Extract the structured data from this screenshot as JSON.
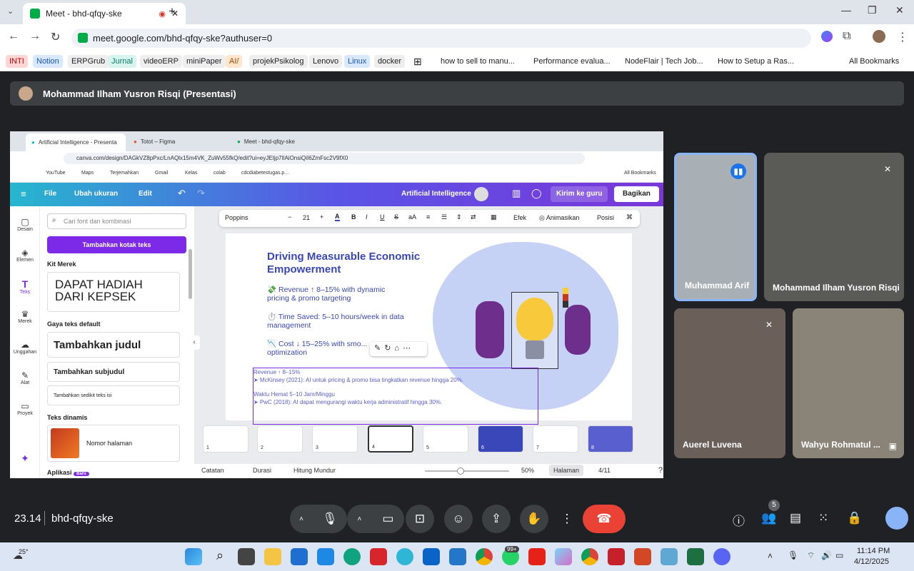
{
  "browser": {
    "tab_title": "Meet - bhd-qfqy-ske",
    "url": "meet.google.com/bhd-qfqy-ske?authuser=0",
    "bookmarks": [
      "INTI",
      "Notion",
      "ERPGrub",
      "Jurnal",
      "videoERP",
      "miniPaper",
      "AI/",
      "projekPsikolog",
      "Lenovo",
      "Linux",
      "docker",
      "how to sell to manu...",
      "Performance evalua...",
      "NodeFlair | Tech Job...",
      "How to Setup a Ras...",
      "All Bookmarks"
    ]
  },
  "meet": {
    "presenter_label": "Mohammad Ilham Yusron Risqi (Presentasi)",
    "time": "23.14",
    "code": "bhd-qfqy-ske",
    "participant_count": "5",
    "participants": [
      {
        "name": "Muhammad Arif"
      },
      {
        "name": "Mohammad Ilham Yusron Risqi"
      },
      {
        "name": "Auerel Luvena"
      },
      {
        "name": "Wahyu Rohmatul ..."
      }
    ]
  },
  "shared": {
    "tabs": [
      "Artificial Intelligence - Presenta",
      "Totot – Figma",
      "Meet - bhd-qfqy-ske"
    ],
    "url": "canva.com/design/DAGkVZ8pPxc/LnAQlx15m4VK_ZuWv55fkQ/edit?ui=eyJEIjp7IlAiOnsiQiI6ZmFsc2V9fX0",
    "bookmarks": [
      "YouTube",
      "Maps",
      "Terjemahkan",
      "Gmail",
      "Kelas",
      "colab",
      "cdcdiabetestugas.p...",
      "All Bookmarks"
    ],
    "canva": {
      "file": "File",
      "resize": "Ubah ukuran",
      "edit": "Edit",
      "doc_title": "Artificial Intelligence",
      "send": "Kirim ke guru",
      "share": "Bagikan",
      "sidenav": [
        "Desain",
        "Elemen",
        "Teks",
        "Merek",
        "Unggahan",
        "Alat",
        "Proyek"
      ],
      "search_placeholder": "Cari font dan kombinasi",
      "add_textbox": "Tambahkan kotak teks",
      "kit": "Kit Merek",
      "brand_text": "DAPAT HADIAH DARI KEPSEK",
      "default_styles": "Gaya teks default",
      "add_title": "Tambahkan judul",
      "add_subtitle": "Tambahkan subjudul",
      "add_body": "Tambahkan sedikit teks isi",
      "dynamic": "Teks dinamis",
      "page_number": "Nomor halaman",
      "apps": "Aplikasi",
      "new_badge": "Baru",
      "font": "Poppins",
      "font_size": "21",
      "effects": "Efek",
      "animate": "Animasikan",
      "position": "Posisi",
      "slide_title": "Driving Measurable Economic Empowerment",
      "bullets": [
        "💸 Revenue ↑ 8–15% with dynamic pricing & promo targeting",
        "⏱️ Time Saved: 5–10 hours/week in data management",
        "📉 Cost ↓ 15–25% with smo... optimization"
      ],
      "notes": [
        "Revenue ↑ 8–15%",
        "➤ McKinsey (2021): AI untuk pricing & promo bisa tingkatkan revenue hingga 20%.",
        "Waktu Hemat 5–10 Jam/Minggu",
        "➤ PwC (2018): AI dapat mengurangi waktu kerja administratif hingga 30%."
      ],
      "thumb_numbers": [
        "1",
        "2",
        "3",
        "4",
        "5",
        "6",
        "7",
        "8"
      ],
      "footer": {
        "notes": "Catatan",
        "duration": "Durasi",
        "timer": "Hitung Mundur",
        "zoom": "50%",
        "pages": "Halaman",
        "page": "4/11"
      }
    }
  },
  "taskbar": {
    "temp": "25°",
    "time": "11:14 PM",
    "date": "4/12/2025",
    "badge": "99+"
  },
  "colors": {
    "canva_purple": "#7d2ae8",
    "meet_red": "#ea4335",
    "slide_title": "#3a47b8"
  }
}
